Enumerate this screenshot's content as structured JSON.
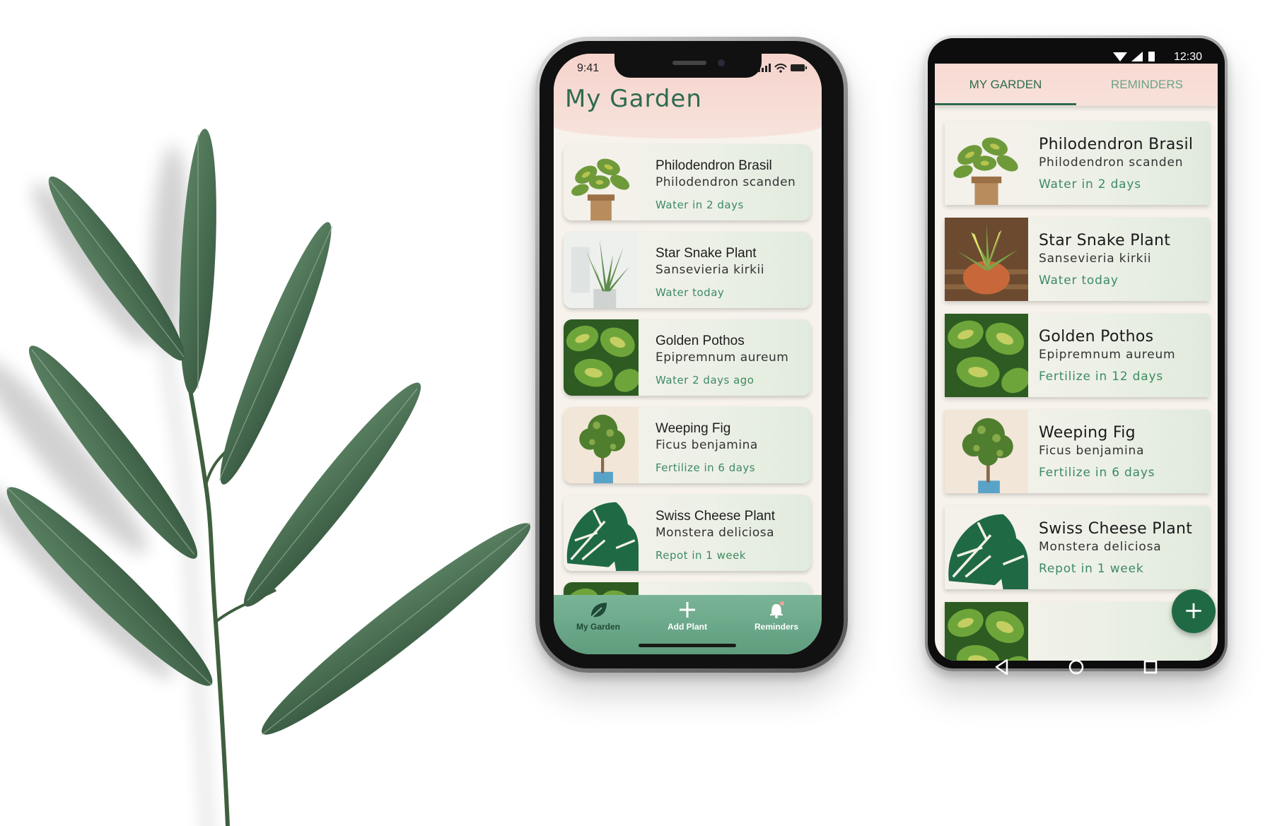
{
  "iphone": {
    "status_time": "9:41",
    "title": "My Garden",
    "plants": [
      {
        "name": "Philodendron Brasil",
        "scientific": "Philodendron scanden",
        "status": "Water in 2 days",
        "thumb": "philodendron"
      },
      {
        "name": "Star Snake Plant",
        "scientific": "Sansevieria kirkii",
        "status": "Water today",
        "thumb": "snake"
      },
      {
        "name": "Golden Pothos",
        "scientific": "Epipremnum aureum",
        "status": "Water 2 days ago",
        "thumb": "pothos"
      },
      {
        "name": "Weeping Fig",
        "scientific": "Ficus benjamina",
        "status": "Fertilize in 6 days",
        "thumb": "fig"
      },
      {
        "name": "Swiss Cheese Plant",
        "scientific": "Monstera deliciosa",
        "status": "Repot in 1 week",
        "thumb": "monstera"
      }
    ],
    "tabbar": [
      {
        "label": "My Garden",
        "icon": "leaf-icon",
        "active": true
      },
      {
        "label": "Add Plant",
        "icon": "plus-icon",
        "active": false
      },
      {
        "label": "Reminders",
        "icon": "bell-icon",
        "active": false
      }
    ]
  },
  "android": {
    "status_time": "12:30",
    "tabs": [
      {
        "label": "MY GARDEN",
        "active": true
      },
      {
        "label": "REMINDERS",
        "active": false
      }
    ],
    "plants": [
      {
        "name": "Philodendron Brasil",
        "scientific": "Philodendron scanden",
        "status": "Water in 2 days",
        "thumb": "philodendron"
      },
      {
        "name": "Star Snake Plant",
        "scientific": "Sansevieria kirkii",
        "status": "Water today",
        "thumb": "snake"
      },
      {
        "name": "Golden Pothos",
        "scientific": "Epipremnum aureum",
        "status": "Fertilize in 12 days",
        "thumb": "pothos"
      },
      {
        "name": "Weeping Fig",
        "scientific": "Ficus benjamina",
        "status": "Fertilize in 6 days",
        "thumb": "fig"
      },
      {
        "name": "Swiss Cheese Plant",
        "scientific": "Monstera deliciosa",
        "status": "Repot in 1 week",
        "thumb": "monstera"
      }
    ],
    "fab_label": "+",
    "nav_buttons": [
      "back-icon",
      "home-icon",
      "recents-icon"
    ]
  },
  "colors": {
    "accent_green": "#2e6b4f",
    "status_green": "#3d8a63",
    "header_pink": "#f6d3cc",
    "tabbar_green": "#6aa888",
    "fab_green": "#1f6a45"
  }
}
